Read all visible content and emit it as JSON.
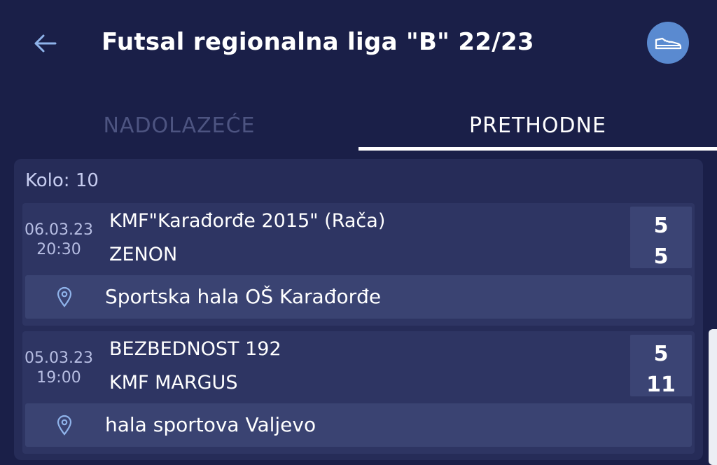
{
  "header": {
    "title": "Futsal regionalna liga \"B\" 22/23",
    "back_icon": "arrow-left-icon",
    "sport_icon": "sneaker-icon"
  },
  "tabs": [
    {
      "label": "NADOLAZEĆE",
      "active": false
    },
    {
      "label": "PRETHODNE",
      "active": true
    }
  ],
  "round": {
    "label": "Kolo: 10",
    "matches": [
      {
        "date": "06.03.23",
        "time": "20:30",
        "home_team": "KMF\"Karađorđe 2015\" (Rača)",
        "away_team": "ZENON",
        "home_score": "5",
        "away_score": "5",
        "venue": "Sportska hala OŠ Karađorđe"
      },
      {
        "date": "05.03.23",
        "time": "19:00",
        "home_team": "BEZBEDNOST 192",
        "away_team": "KMF MARGUS",
        "home_score": "5",
        "away_score": "11",
        "venue": "hala sportova Valjevo"
      }
    ]
  },
  "colors": {
    "background": "#1a1f48",
    "accent_button": "#5a8ad0",
    "card": "#2e3563",
    "inactive_tab": "#4d5481"
  }
}
